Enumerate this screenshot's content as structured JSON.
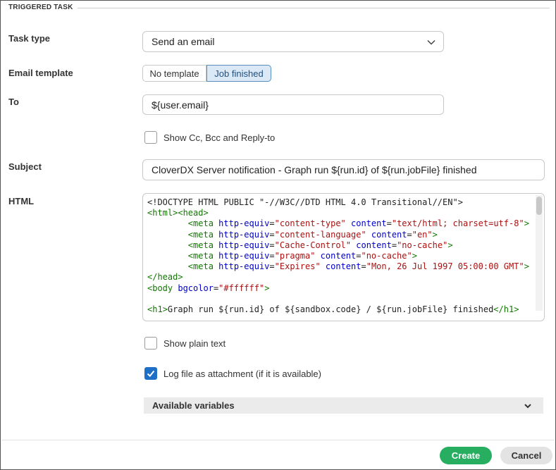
{
  "section": {
    "title": "TRIGGERED TASK"
  },
  "labels": {
    "task_type": "Task type",
    "email_template": "Email template",
    "to": "To",
    "subject": "Subject",
    "html": "HTML"
  },
  "task_type": {
    "selected": "Send an email"
  },
  "email_template": {
    "options": [
      "No template",
      "Job finished"
    ],
    "selected": "Job finished"
  },
  "to": {
    "value": "${user.email}"
  },
  "checkboxes": {
    "show_cc": {
      "label": "Show Cc, Bcc and Reply-to",
      "checked": false
    },
    "plain_text": {
      "label": "Show plain text",
      "checked": false
    },
    "log_attachment": {
      "label": "Log file as attachment (if it is available)",
      "checked": true
    }
  },
  "subject": {
    "value": "CloverDX Server notification - Graph run ${run.id} of ${run.jobFile} finished"
  },
  "html_code": [
    "<!DOCTYPE HTML PUBLIC \"-//W3C//DTD HTML 4.0 Transitional//EN\">",
    "<html><head>",
    "        <meta http-equiv=\"content-type\" content=\"text/html; charset=utf-8\">",
    "        <meta http-equiv=\"content-language\" content=\"en\">",
    "        <meta http-equiv=\"Cache-Control\" content=\"no-cache\">",
    "        <meta http-equiv=\"pragma\" content=\"no-cache\">",
    "        <meta http-equiv=\"Expires\" content=\"Mon, 26 Jul 1997 05:00:00 GMT\">",
    "</head>",
    "<body bgcolor=\"#ffffff\">",
    "",
    "<h1>Graph run ${run.id} of ${sandbox.code} / ${run.jobFile} finished</h1>"
  ],
  "accordion": {
    "label": "Available variables"
  },
  "buttons": {
    "create": "Create",
    "cancel": "Cancel"
  },
  "colors": {
    "accent": "#1e6fc7",
    "create": "#27ae60",
    "code_tag": "#117700",
    "code_attr": "#0000cc",
    "code_string": "#aa1111"
  }
}
